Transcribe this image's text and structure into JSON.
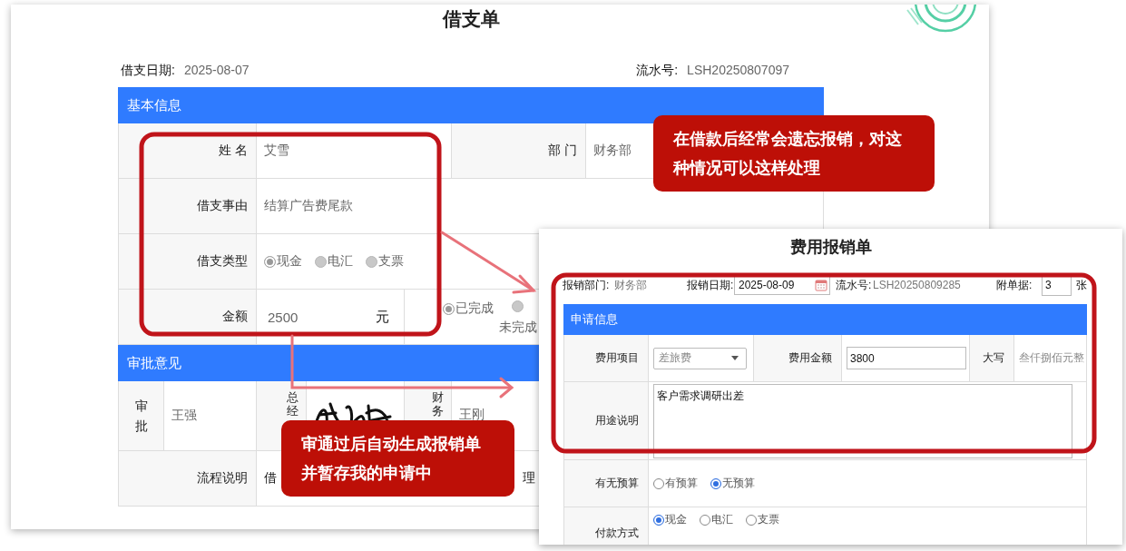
{
  "loan_form": {
    "title": "借支单",
    "date_label": "借支日期:",
    "date": "2025-08-07",
    "serial_label": "流水号:",
    "serial": "LSH20250807097",
    "basic_info": {
      "title": "基本信息",
      "name_label": "姓 名",
      "name": "艾雪",
      "dept_label": "部 门",
      "dept": "财务部",
      "reason_label": "借支事由",
      "reason": "结算广告费尾款",
      "type_label": "借支类型",
      "type_options": [
        {
          "label": "现金",
          "selected": true
        },
        {
          "label": "电汇",
          "selected": false
        },
        {
          "label": "支票",
          "selected": false
        }
      ],
      "amount_label": "金额",
      "amount": "2500",
      "unit": "元",
      "status_options": [
        {
          "label": "已完成",
          "selected": true
        },
        {
          "label": "未完成",
          "selected": false
        }
      ]
    },
    "approval": {
      "title": "审批意见",
      "approver_label": "审批",
      "approver": "王强",
      "gm_label": "总经",
      "finance_label": "财务",
      "finance_approver": "王刚",
      "flow_label": "流程说明",
      "flow_text_start": "借",
      "flow_text_end": "理"
    }
  },
  "expense_form": {
    "title": "费用报销单",
    "dept_label": "报销部门:",
    "dept": "财务部",
    "date_label": "报销日期:",
    "date": "2025-08-09",
    "serial_label": "流水号:",
    "serial": "LSH20250809285",
    "attach_label": "附单据:",
    "attach": "3",
    "attach_unit": "张",
    "section_title": "申请信息",
    "item_label": "费用项目",
    "item": "差旅费",
    "amount_label": "费用金额",
    "amount": "3800",
    "capital_label": "大写",
    "capital": "叁仟捌佰元整",
    "purpose_label": "用途说明",
    "purpose": "客户需求调研出差",
    "budget_label": "有无预算",
    "budget_options": [
      {
        "label": "有预算",
        "selected": false
      },
      {
        "label": "无预算",
        "selected": true
      }
    ],
    "payment_label": "付款方式",
    "payment_options": [
      {
        "label": "现金",
        "selected": true
      },
      {
        "label": "电汇",
        "selected": false
      },
      {
        "label": "支票",
        "selected": false
      }
    ]
  },
  "callouts": [
    {
      "text": "在借款后经常会遗忘报销，对这种情况可以这样处理"
    },
    {
      "text": "审通过后自动生成报销单并暂存我的申请中"
    }
  ]
}
